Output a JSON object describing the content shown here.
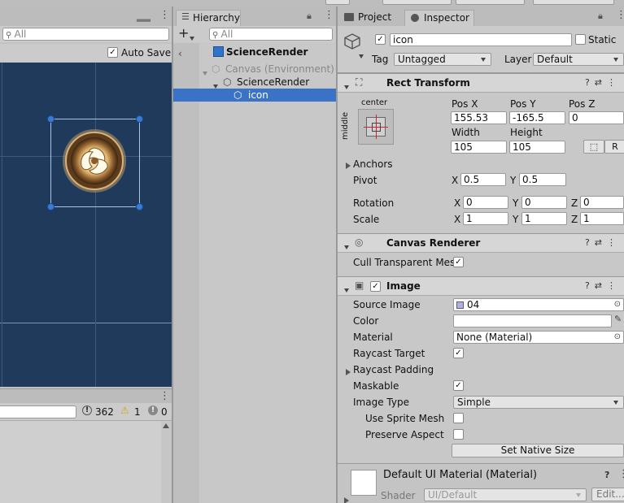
{
  "scene": {
    "search_placeholder": "All",
    "auto_save_label": "Auto Save",
    "auto_save_checked": "✓",
    "colors": {
      "canvas_bg": "#1f3a5a",
      "selection": "#3a7bd5"
    }
  },
  "console": {
    "count_info": "362",
    "count_warn": "1",
    "count_error": "0"
  },
  "hierarchy": {
    "tab_label": "Hierarchy",
    "search_placeholder": "All",
    "scene_name": "ScienceRender",
    "items": [
      {
        "label": "Canvas (Environment)"
      },
      {
        "label": "ScienceRender"
      },
      {
        "label": "icon"
      }
    ]
  },
  "inspector": {
    "tabs": {
      "project": "Project",
      "inspector": "Inspector"
    },
    "object": {
      "name": "icon",
      "active_check": "✓",
      "static_label": "Static",
      "tag_label": "Tag",
      "tag_value": "Untagged",
      "layer_label": "Layer",
      "layer_value": "Default"
    },
    "rect_transform": {
      "title": "Rect Transform",
      "anchor_h": "center",
      "anchor_v": "middle",
      "pos_x_label": "Pos X",
      "pos_y_label": "Pos Y",
      "pos_z_label": "Pos Z",
      "pos_x": "155.53",
      "pos_y": "-165.5",
      "pos_z": "0",
      "width_label": "Width",
      "height_label": "Height",
      "width": "105",
      "height": "105",
      "r_button": "R",
      "anchors_label": "Anchors",
      "pivot_label": "Pivot",
      "pivot_x": "0.5",
      "pivot_y": "0.5",
      "rotation_label": "Rotation",
      "rot_x": "0",
      "rot_y": "0",
      "rot_z": "0",
      "scale_label": "Scale",
      "scale_x": "1",
      "scale_y": "1",
      "scale_z": "1",
      "x": "X",
      "y": "Y",
      "z": "Z"
    },
    "canvas_renderer": {
      "title": "Canvas Renderer",
      "cull_label": "Cull Transparent Mes",
      "cull_check": "✓"
    },
    "image": {
      "title": "Image",
      "enabled_check": "✓",
      "source_image_label": "Source Image",
      "source_image_value": "04",
      "color_label": "Color",
      "material_label": "Material",
      "material_value": "None (Material)",
      "raycast_target_label": "Raycast Target",
      "raycast_target_check": "✓",
      "raycast_padding_label": "Raycast Padding",
      "maskable_label": "Maskable",
      "maskable_check": "✓",
      "image_type_label": "Image Type",
      "image_type_value": "Simple",
      "use_sprite_mesh_label": "Use Sprite Mesh",
      "preserve_aspect_label": "Preserve Aspect",
      "set_native_size": "Set Native Size"
    },
    "material": {
      "title": "Default UI Material (Material)",
      "shader_label": "Shader",
      "shader_value": "UI/Default",
      "edit_button": "Edit..."
    }
  }
}
